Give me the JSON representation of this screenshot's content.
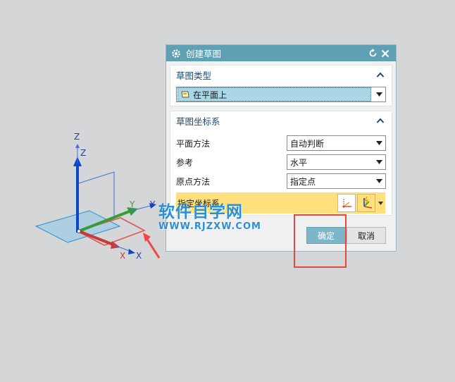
{
  "dialog": {
    "title": "创建草图",
    "section_type": {
      "header": "草图类型",
      "selected": "在平面上"
    },
    "section_csys": {
      "header": "草图坐标系",
      "rows": [
        {
          "label": "平面方法",
          "value": "自动判断"
        },
        {
          "label": "参考",
          "value": "水平"
        },
        {
          "label": "原点方法",
          "value": "指定点"
        }
      ],
      "specify_label": "指定坐标系"
    },
    "ok_label": "确定",
    "cancel_label": "取消"
  },
  "triad": {
    "axis_z": "Z",
    "axis_z2": "Z",
    "axis_y": "Y",
    "axis_y2": "Y",
    "axis_x": "X",
    "axis_x2": "X"
  },
  "watermark": {
    "main": "软件自学网",
    "sub": "WWW.RJZXW.COM"
  },
  "colors": {
    "titlebar": "#5fa0b5",
    "section_header": "#1f4a77",
    "selected_fill": "#a9d7e6",
    "specify_highlight": "#ffe07c",
    "ok_button": "#7db6c9",
    "annotation_red": "#e54646",
    "watermark_blue": "#2a8fd6"
  }
}
